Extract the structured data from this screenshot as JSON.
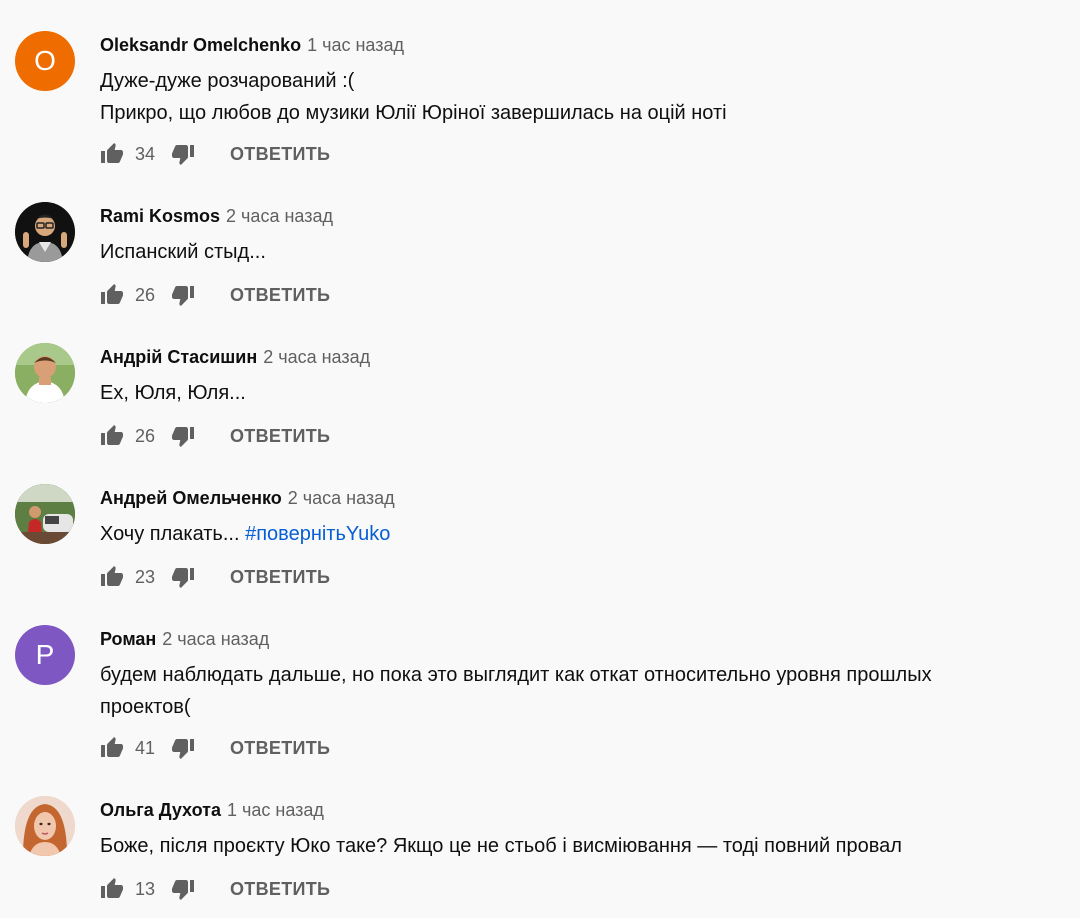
{
  "comments": [
    {
      "author": "Oleksandr Omelchenko",
      "time": "1 час назад",
      "lines": [
        "Дуже-дуже розчарований :(",
        "Прикро, що любов до музики Юлії Юріної завершилась на оцій ноті"
      ],
      "likes": "34",
      "reply_label": "ОТВЕТИТЬ",
      "avatar_letter": "O",
      "avatar_color": "#ef6c00"
    },
    {
      "author": "Rami Kosmos",
      "time": "2 часа назад",
      "lines": [
        "Испанский стыд..."
      ],
      "likes": "26",
      "reply_label": "ОТВЕТИТЬ"
    },
    {
      "author": "Андрій Стасишин",
      "time": "2 часа назад",
      "lines": [
        "Ех, Юля, Юля..."
      ],
      "likes": "26",
      "reply_label": "ОТВЕТИТЬ"
    },
    {
      "author": "Андрей Омельченко",
      "time": "2 часа назад",
      "lines": [
        "Хочу плакать..."
      ],
      "hashtag": "#повернітьYuko",
      "likes": "23",
      "reply_label": "ОТВЕТИТЬ"
    },
    {
      "author": "Роман",
      "time": "2 часа назад",
      "lines": [
        "будем наблюдать дальше, но пока это выглядит как откат относительно уровня прошлых проектов("
      ],
      "likes": "41",
      "reply_label": "ОТВЕТИТЬ",
      "avatar_letter": "P",
      "avatar_color": "#7e57c2"
    },
    {
      "author": "Ольга Духота",
      "time": "1 час назад",
      "lines": [
        "Боже, після проєкту Юко таке? Якщо це не стьоб і висміювання — тоді повний провал"
      ],
      "likes": "13",
      "reply_label": "ОТВЕТИТЬ"
    }
  ],
  "colors": {
    "background": "#f9f9f9",
    "text": "#0f0f0f",
    "secondary": "#606060",
    "link": "#065fd4"
  },
  "icons": [
    "like-icon",
    "dislike-icon"
  ]
}
